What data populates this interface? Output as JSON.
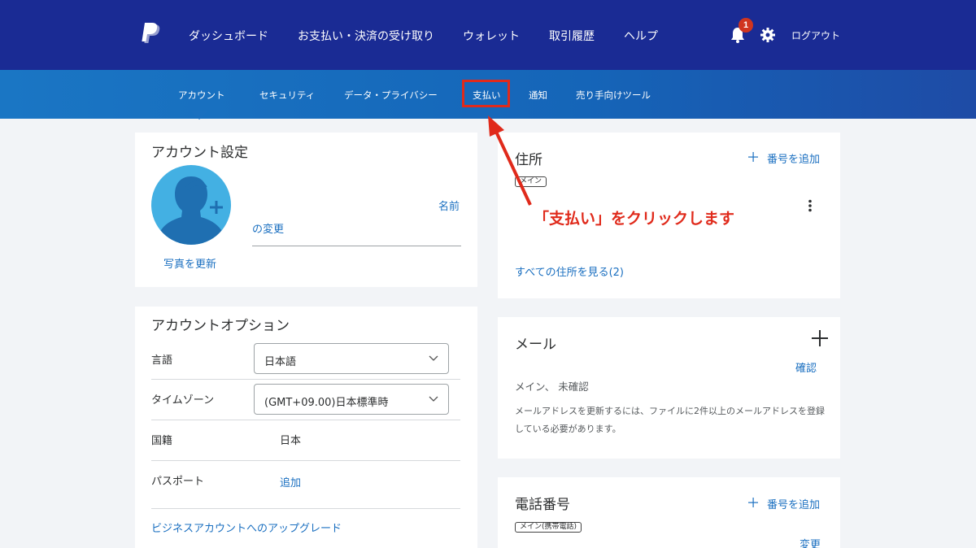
{
  "topbar": {
    "nav": [
      "ダッシュボード",
      "お支払い・決済の受け取り",
      "ウォレット",
      "取引履歴",
      "ヘルプ"
    ],
    "notification_count": "1",
    "logout": "ログアウト"
  },
  "subnav": {
    "items": [
      "アカウント",
      "セキュリティ",
      "データ・プライバシー",
      "支払い",
      "通知",
      "売り手向けツール"
    ]
  },
  "annotation": {
    "text": "「支払い」をクリックします"
  },
  "account_settings": {
    "title": "アカウント設定",
    "update_photo": "写真を更新",
    "name_link_line1": "名前",
    "name_link_line2": "の変更"
  },
  "account_options": {
    "title": "アカウントオプション",
    "language_label": "言語",
    "language_value": "日本語",
    "timezone_label": "タイムゾーン",
    "timezone_value": "(GMT+09.00)日本標準時",
    "nationality_label": "国籍",
    "nationality_value": "日本",
    "passport_label": "パスポート",
    "passport_add": "追加",
    "upgrade_link": "ビジネスアカウントへのアップグレード"
  },
  "address": {
    "title": "住所",
    "add_link": "番号を追加",
    "tag": "メイン",
    "view_all": "すべての住所を見る(2)"
  },
  "email": {
    "title": "メール",
    "confirm": "確認",
    "status": "メイン、 未確認",
    "note": "メールアドレスを更新するには、ファイルに2件以上のメールアドレスを登録している必要があります。"
  },
  "phone": {
    "title": "電話番号",
    "add_link": "番号を追加",
    "tag": "メイン(携帯電話)",
    "change": "変更"
  },
  "colors": {
    "topbar": "#1a2b94",
    "subbar": "#1a76c4",
    "link": "#1a6fc0",
    "annotation": "#e02a1b",
    "avatar": "#43b0e3"
  }
}
